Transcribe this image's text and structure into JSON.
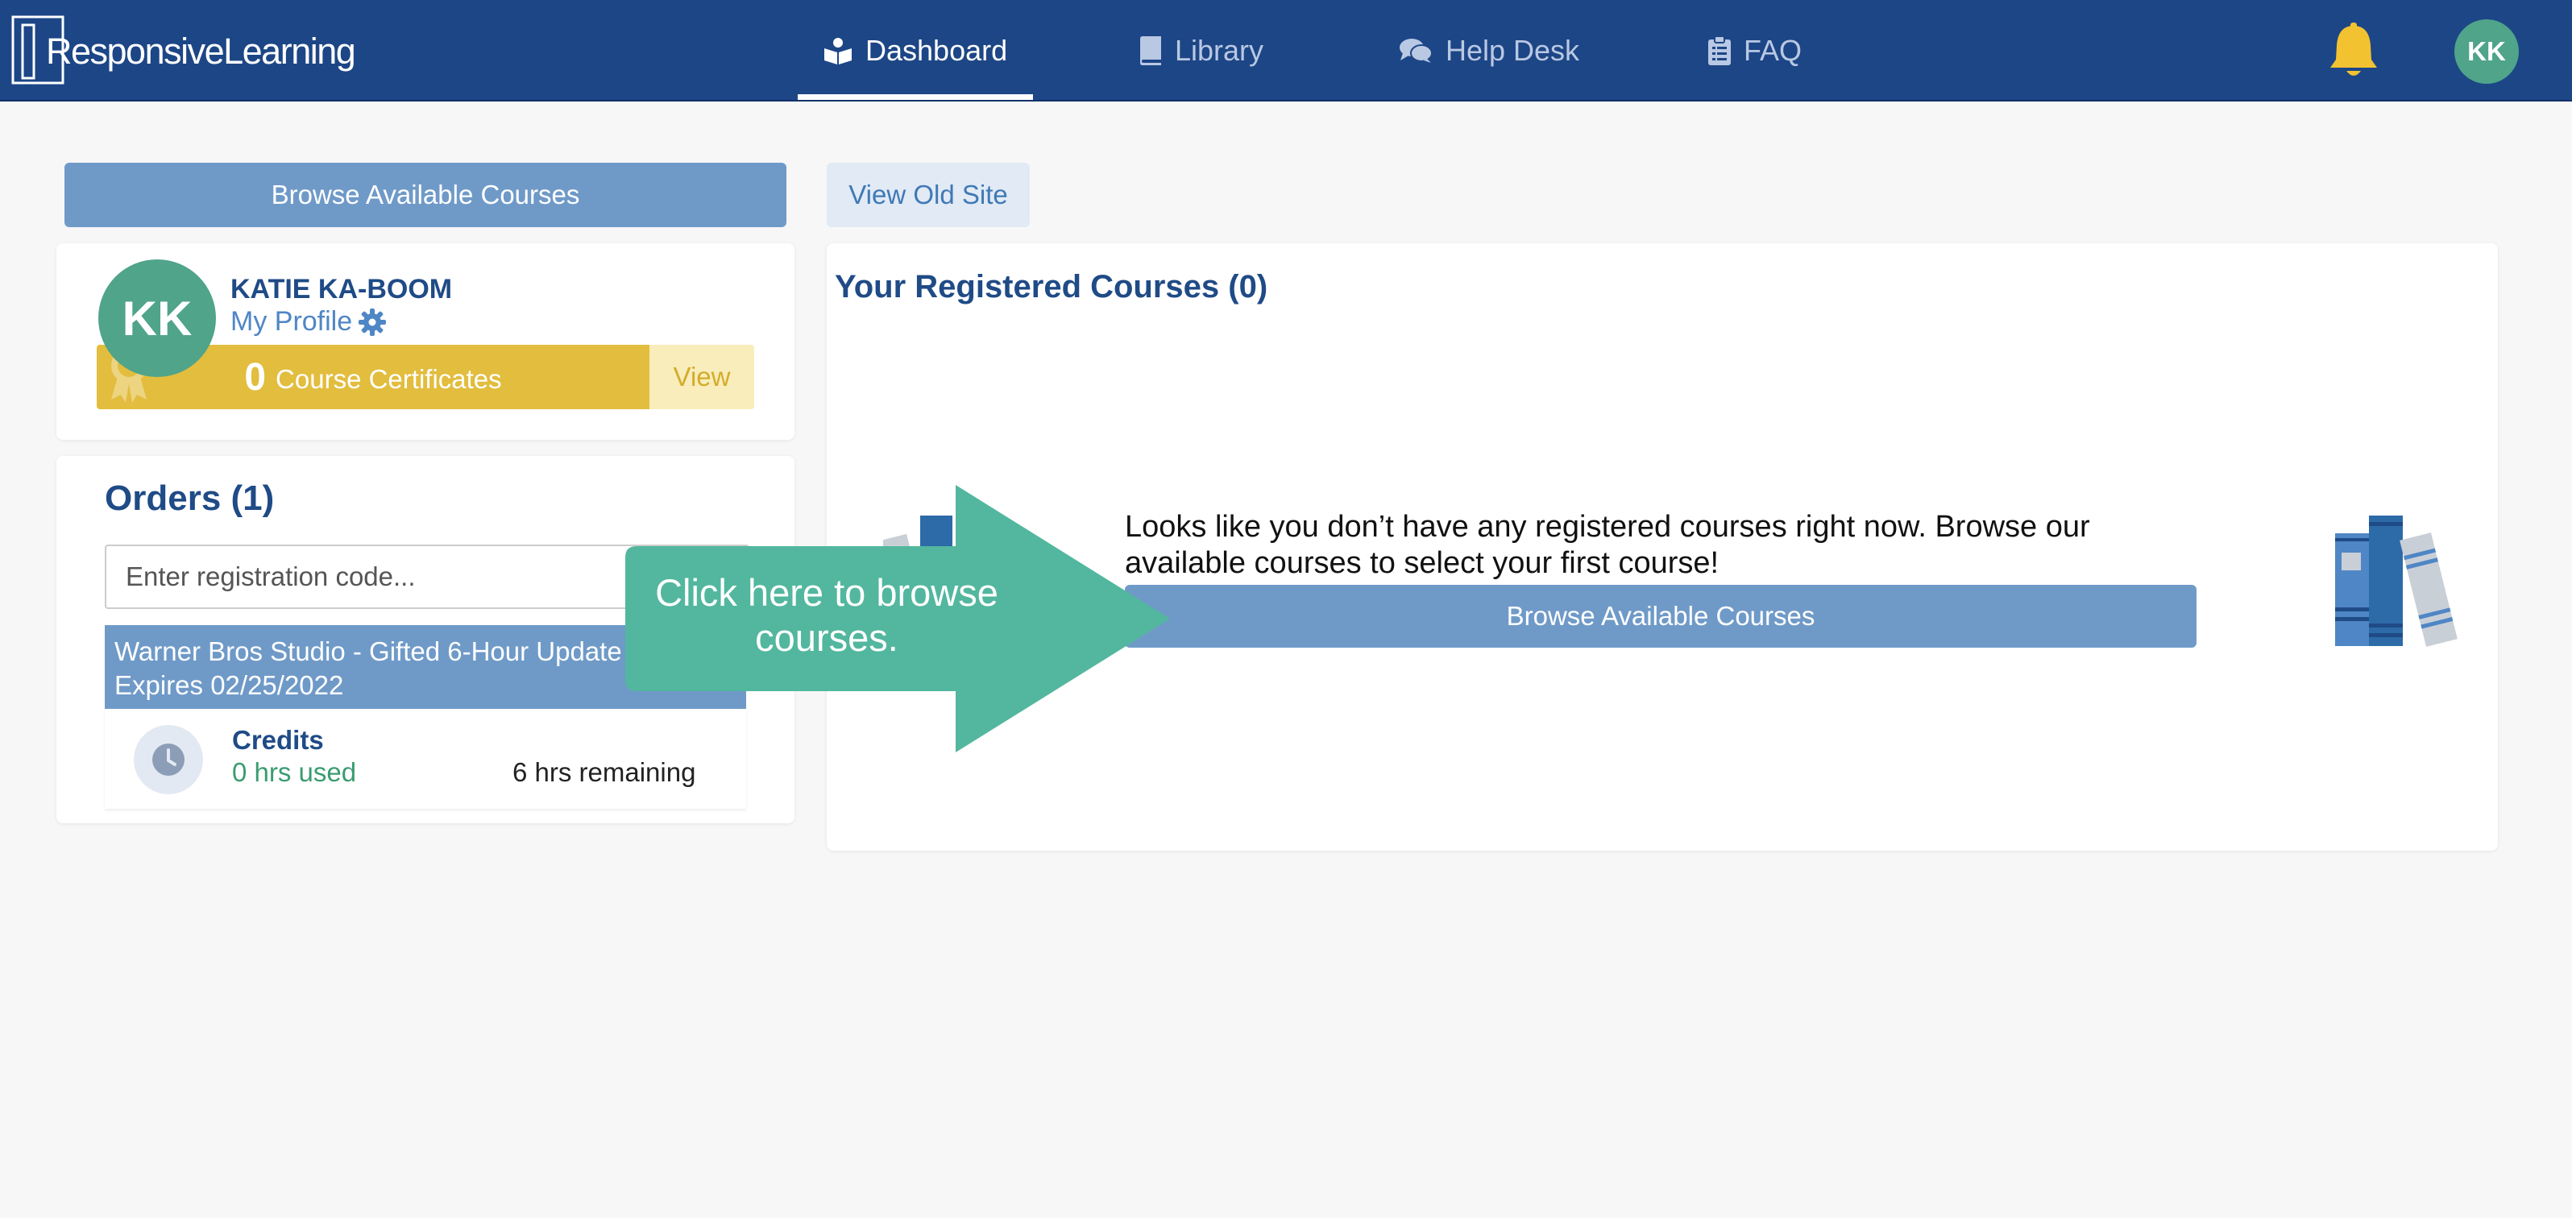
{
  "brand": {
    "name": "ResponsiveLearning"
  },
  "nav": {
    "items": [
      {
        "label": "Dashboard",
        "icon": "book-reader-icon",
        "active": true
      },
      {
        "label": "Library",
        "icon": "book-icon",
        "active": false
      },
      {
        "label": "Help Desk",
        "icon": "comments-icon",
        "active": false
      },
      {
        "label": "FAQ",
        "icon": "clipboard-icon",
        "active": false
      }
    ],
    "avatar_initials": "KK",
    "bell_icon": "bell-icon"
  },
  "actions": {
    "browse_label": "Browse Available Courses",
    "old_site_label": "View Old Site"
  },
  "profile": {
    "initials": "KK",
    "name": "KATIE KA-BOOM",
    "profile_link": "My Profile",
    "certificates_count": "0",
    "certificates_label": "Course Certificates",
    "view_label": "View"
  },
  "orders": {
    "title": "Orders (1)",
    "registration_placeholder": "Enter registration code...",
    "order_title": "Warner Bros Studio - Gifted 6-Hour Update",
    "order_expires": "Expires 02/25/2022",
    "credits_label": "Credits",
    "hrs_used": "0 hrs used",
    "hrs_remaining": "6 hrs remaining"
  },
  "courses": {
    "title": "Your Registered Courses (0)",
    "empty_message": "Looks like you don’t have any registered courses right now. Browse our available courses to select your first course!",
    "browse_label": "Browse Available Courses"
  },
  "callout": {
    "text": "Click here to browse courses."
  },
  "colors": {
    "navbar": "#1d4686",
    "accent_blue": "#6f9ac8",
    "avatar_green": "#4fa48a",
    "certificate_yellow": "#e2bd3e",
    "callout_green": "#52b79e",
    "bell_yellow": "#f2c230"
  }
}
